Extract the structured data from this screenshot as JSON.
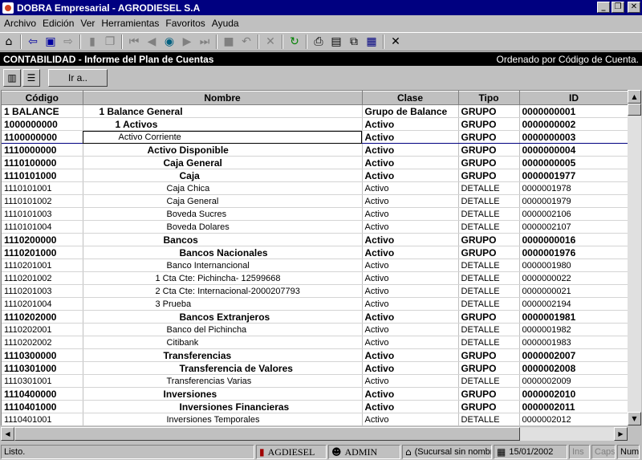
{
  "window": {
    "title": "DOBRA Empresarial - AGRODIESEL S.A",
    "min_label": "_",
    "max_label": "❐",
    "close_label": "✕"
  },
  "menu": [
    {
      "label": "Archivo"
    },
    {
      "label": "Edición"
    },
    {
      "label": "Ver"
    },
    {
      "label": "Herramientas"
    },
    {
      "label": "Favoritos"
    },
    {
      "label": "Ayuda"
    }
  ],
  "toolbar_icons": [
    "home-icon",
    "back-icon",
    "window-icon",
    "forward-icon",
    "new-icon",
    "copy-icon",
    "first-icon",
    "prev-icon",
    "find-icon",
    "next-icon",
    "last-icon",
    "stop-icon",
    "undo-icon",
    "delete-icon",
    "refresh-icon",
    "print-icon",
    "preview-icon",
    "export-icon",
    "save-icon",
    "close-x-icon"
  ],
  "header": {
    "title": "CONTABILIDAD - Informe del Plan de Cuentas",
    "sort_info": "Ordenado por Código de Cuenta."
  },
  "subtoolbar": {
    "goto_label": "Ir a.."
  },
  "grid": {
    "columns": [
      "Código",
      "Nombre",
      "Clase",
      "Tipo",
      "ID"
    ],
    "rows": [
      {
        "codigo": "1 BALANCE",
        "nombre": "1 Balance General",
        "clase": "Grupo de Balance",
        "tipo": "GRUPO",
        "id": "0000000001",
        "bold": true,
        "indent": 20
      },
      {
        "codigo": "1000000000",
        "nombre": "1 Activos",
        "clase": "Activo",
        "tipo": "GRUPO",
        "id": "0000000002",
        "bold": true,
        "indent": 40
      },
      {
        "codigo": "1100000000",
        "nombre": "Activo Corriente",
        "clase": "Activo",
        "tipo": "GRUPO",
        "id": "0000000003",
        "bold": true,
        "indent": 44,
        "selected": true
      },
      {
        "codigo": "1110000000",
        "nombre": "Activo Disponible",
        "clase": "Activo",
        "tipo": "GRUPO",
        "id": "0000000004",
        "bold": true,
        "indent": 80
      },
      {
        "codigo": "1110100000",
        "nombre": "Caja General",
        "clase": "Activo",
        "tipo": "GRUPO",
        "id": "0000000005",
        "bold": true,
        "indent": 100
      },
      {
        "codigo": "1110101000",
        "nombre": "Caja",
        "clase": "Activo",
        "tipo": "GRUPO",
        "id": "0000001977",
        "bold": true,
        "indent": 120
      },
      {
        "codigo": "1110101001",
        "nombre": "Caja Chica",
        "clase": "Activo",
        "tipo": "DETALLE",
        "id": "0000001978",
        "bold": false,
        "indent": 104
      },
      {
        "codigo": "1110101002",
        "nombre": "Caja General",
        "clase": "Activo",
        "tipo": "DETALLE",
        "id": "0000001979",
        "bold": false,
        "indent": 104
      },
      {
        "codigo": "1110101003",
        "nombre": "Boveda Sucres",
        "clase": "Activo",
        "tipo": "DETALLE",
        "id": "0000002106",
        "bold": false,
        "indent": 104
      },
      {
        "codigo": "1110101004",
        "nombre": "Boveda Dolares",
        "clase": "Activo",
        "tipo": "DETALLE",
        "id": "0000002107",
        "bold": false,
        "indent": 104
      },
      {
        "codigo": "1110200000",
        "nombre": "Bancos",
        "clase": "Activo",
        "tipo": "GRUPO",
        "id": "0000000016",
        "bold": true,
        "indent": 100
      },
      {
        "codigo": "1110201000",
        "nombre": "Bancos Nacionales",
        "clase": "Activo",
        "tipo": "GRUPO",
        "id": "0000001976",
        "bold": true,
        "indent": 120
      },
      {
        "codigo": "1110201001",
        "nombre": "Banco Internancional",
        "clase": "Activo",
        "tipo": "DETALLE",
        "id": "0000001980",
        "bold": false,
        "indent": 104
      },
      {
        "codigo": "1110201002",
        "nombre": "1 Cta Cte: Pichincha- 12599668",
        "clase": "Activo",
        "tipo": "DETALLE",
        "id": "0000000022",
        "bold": false,
        "indent": 90
      },
      {
        "codigo": "1110201003",
        "nombre": "2 Cta Cte: Internacional-2000207793",
        "clase": "Activo",
        "tipo": "DETALLE",
        "id": "0000000021",
        "bold": false,
        "indent": 90
      },
      {
        "codigo": "1110201004",
        "nombre": "3 Prueba",
        "clase": "Activo",
        "tipo": "DETALLE",
        "id": "0000002194",
        "bold": false,
        "indent": 90
      },
      {
        "codigo": "1110202000",
        "nombre": "Bancos Extranjeros",
        "clase": "Activo",
        "tipo": "GRUPO",
        "id": "0000001981",
        "bold": true,
        "indent": 120
      },
      {
        "codigo": "1110202001",
        "nombre": "Banco del Pichincha",
        "clase": "Activo",
        "tipo": "DETALLE",
        "id": "0000001982",
        "bold": false,
        "indent": 104
      },
      {
        "codigo": "1110202002",
        "nombre": "Citibank",
        "clase": "Activo",
        "tipo": "DETALLE",
        "id": "0000001983",
        "bold": false,
        "indent": 104
      },
      {
        "codigo": "1110300000",
        "nombre": "Transferencias",
        "clase": "Activo",
        "tipo": "GRUPO",
        "id": "0000002007",
        "bold": true,
        "indent": 100
      },
      {
        "codigo": "1110301000",
        "nombre": "Transferencia de Valores",
        "clase": "Activo",
        "tipo": "GRUPO",
        "id": "0000002008",
        "bold": true,
        "indent": 120
      },
      {
        "codigo": "1110301001",
        "nombre": "Transferencias Varias",
        "clase": "Activo",
        "tipo": "DETALLE",
        "id": "0000002009",
        "bold": false,
        "indent": 104
      },
      {
        "codigo": "1110400000",
        "nombre": "Inversiones",
        "clase": "Activo",
        "tipo": "GRUPO",
        "id": "0000002010",
        "bold": true,
        "indent": 100
      },
      {
        "codigo": "1110401000",
        "nombre": "Inversiones Financieras",
        "clase": "Activo",
        "tipo": "GRUPO",
        "id": "0000002011",
        "bold": true,
        "indent": 120
      },
      {
        "codigo": "1110401001",
        "nombre": "Inversiones Temporales",
        "clase": "Activo",
        "tipo": "DETALLE",
        "id": "0000002012",
        "bold": false,
        "indent": 104
      }
    ]
  },
  "status": {
    "message": "Listo.",
    "company": "AGDIESEL",
    "user": "ADMIN",
    "branch": "(Sucursal sin nombre)",
    "date": "15/01/2002",
    "ins": "Ins",
    "caps": "Caps",
    "num": "Num"
  }
}
